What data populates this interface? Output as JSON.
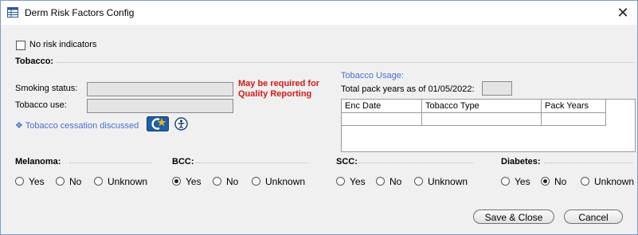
{
  "window": {
    "title": "Derm Risk Factors Config",
    "close_glyph": "✕"
  },
  "no_risk": {
    "label": "No risk indicators",
    "checked": false
  },
  "tobacco": {
    "section_title": "Tobacco:",
    "smoking_status_label": "Smoking status:",
    "smoking_status_value": "",
    "tobacco_use_label": "Tobacco use:",
    "tobacco_use_value": "",
    "warning_line1": "May be required for",
    "warning_line2": "Quality Reporting",
    "cessation_link": "Tobacco cessation discussed",
    "usage_title": "Tobacco Usage:",
    "pack_years_label": "Total pack years as of 01/05/2022:",
    "pack_years_value": "",
    "grid_columns": [
      "Enc Date",
      "Tobacco Type",
      "Pack Years"
    ]
  },
  "conditions": [
    {
      "name": "Melanoma:",
      "options": [
        "Yes",
        "No",
        "Unknown"
      ],
      "selected": null
    },
    {
      "name": "BCC:",
      "options": [
        "Yes",
        "No",
        "Unknown"
      ],
      "selected": "Yes"
    },
    {
      "name": "SCC:",
      "options": [
        "Yes",
        "No",
        "Unknown"
      ],
      "selected": null
    },
    {
      "name": "Diabetes:",
      "options": [
        "Yes",
        "No",
        "Unknown"
      ],
      "selected": "No"
    }
  ],
  "buttons": {
    "save_close": "Save & Close",
    "cancel": "Cancel"
  },
  "colors": {
    "warning": "#d41a1a",
    "link": "#4a6fcf",
    "accent_icon": "#1f5fa8"
  },
  "icons": [
    "table-icon",
    "close-icon",
    "cessation-icon",
    "info-person-icon"
  ]
}
